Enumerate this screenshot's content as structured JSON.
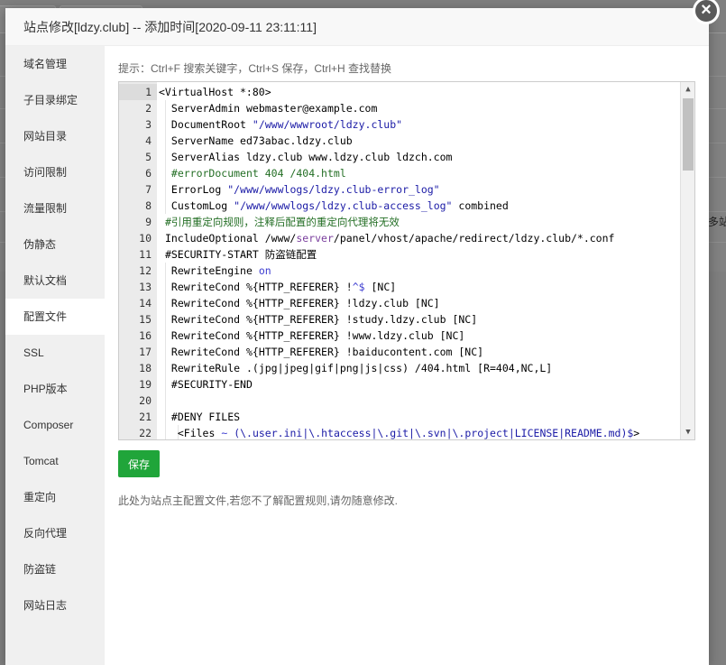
{
  "background": {
    "right_text": "多站"
  },
  "modal": {
    "title": "站点修改[ldzy.club] -- 添加时间[2020-09-11 23:11:11]",
    "close_glyph": "×"
  },
  "sidebar": {
    "items": [
      {
        "label": "域名管理"
      },
      {
        "label": "子目录绑定"
      },
      {
        "label": "网站目录"
      },
      {
        "label": "访问限制"
      },
      {
        "label": "流量限制"
      },
      {
        "label": "伪静态"
      },
      {
        "label": "默认文档"
      },
      {
        "label": "配置文件",
        "active": true
      },
      {
        "label": "SSL"
      },
      {
        "label": "PHP版本"
      },
      {
        "label": "Composer"
      },
      {
        "label": "Tomcat"
      },
      {
        "label": "重定向"
      },
      {
        "label": "反向代理"
      },
      {
        "label": "防盗链"
      },
      {
        "label": "网站日志"
      }
    ]
  },
  "content": {
    "tip": "提示：Ctrl+F 搜索关键字，Ctrl+S 保存，Ctrl+H 查找替换",
    "save_label": "保存",
    "note": "此处为站点主配置文件,若您不了解配置规则,请勿随意修改."
  },
  "editor": {
    "active_line": 1,
    "lines": [
      {
        "n": "1",
        "indent": 0,
        "parts": [
          [
            "d",
            "<VirtualHost *:80>"
          ]
        ]
      },
      {
        "n": "2",
        "indent": 2,
        "parts": [
          [
            "d",
            "ServerAdmin webmaster@example.com"
          ]
        ]
      },
      {
        "n": "3",
        "indent": 2,
        "parts": [
          [
            "d",
            "DocumentRoot "
          ],
          [
            "s",
            "\"/www/wwwroot/ldzy.club\""
          ]
        ]
      },
      {
        "n": "4",
        "indent": 2,
        "parts": [
          [
            "d",
            "ServerName ed73abac.ldzy.club"
          ]
        ]
      },
      {
        "n": "5",
        "indent": 2,
        "parts": [
          [
            "d",
            "ServerAlias ldzy.club www.ldzy.club ldzch.com"
          ]
        ]
      },
      {
        "n": "6",
        "indent": 2,
        "parts": [
          [
            "c",
            "#errorDocument 404 /404.html"
          ]
        ]
      },
      {
        "n": "7",
        "indent": 2,
        "parts": [
          [
            "d",
            "ErrorLog "
          ],
          [
            "s",
            "\"/www/wwwlogs/ldzy.club-error_log\""
          ]
        ]
      },
      {
        "n": "8",
        "indent": 2,
        "parts": [
          [
            "d",
            "CustomLog "
          ],
          [
            "s",
            "\"/www/wwwlogs/ldzy.club-access_log\""
          ],
          [
            "d",
            " combined"
          ]
        ]
      },
      {
        "n": "9",
        "indent": 1,
        "parts": [
          [
            "c",
            "#引用重定向规则，注释后配置的重定向代理将无效"
          ]
        ]
      },
      {
        "n": "10",
        "indent": 1,
        "parts": [
          [
            "d",
            "IncludeOptional /www/"
          ],
          [
            "p",
            "server"
          ],
          [
            "d",
            "/panel/vhost/apache/redirect/ldzy.club/*.conf"
          ]
        ]
      },
      {
        "n": "11",
        "indent": 1,
        "parts": [
          [
            "d",
            "#SECURITY-START 防盗链配置"
          ]
        ]
      },
      {
        "n": "12",
        "indent": 2,
        "parts": [
          [
            "d",
            "RewriteEngine "
          ],
          [
            "k",
            "on"
          ]
        ]
      },
      {
        "n": "13",
        "indent": 2,
        "parts": [
          [
            "d",
            "RewriteCond %{HTTP_REFERER} !"
          ],
          [
            "k",
            "^$"
          ],
          [
            "d",
            " [NC]"
          ]
        ]
      },
      {
        "n": "14",
        "indent": 2,
        "parts": [
          [
            "d",
            "RewriteCond %{HTTP_REFERER} !ldzy.club [NC]"
          ]
        ]
      },
      {
        "n": "15",
        "indent": 2,
        "parts": [
          [
            "d",
            "RewriteCond %{HTTP_REFERER} !study.ldzy.club [NC]"
          ]
        ]
      },
      {
        "n": "16",
        "indent": 2,
        "parts": [
          [
            "d",
            "RewriteCond %{HTTP_REFERER} !www.ldzy.club [NC]"
          ]
        ]
      },
      {
        "n": "17",
        "indent": 2,
        "parts": [
          [
            "d",
            "RewriteCond %{HTTP_REFERER} !baiducontent.com [NC]"
          ]
        ]
      },
      {
        "n": "18",
        "indent": 2,
        "parts": [
          [
            "d",
            "RewriteRule .(jpg|jpeg|gif|png|js|css) /404.html [R=404,NC,L]"
          ]
        ]
      },
      {
        "n": "19",
        "indent": 2,
        "parts": [
          [
            "d",
            "#SECURITY-END"
          ]
        ]
      },
      {
        "n": "20",
        "indent": 2,
        "parts": [
          [
            "d",
            ""
          ]
        ]
      },
      {
        "n": "21",
        "indent": 2,
        "parts": [
          [
            "d",
            "#DENY FILES"
          ]
        ]
      },
      {
        "n": "22",
        "indent": 3,
        "parts": [
          [
            "d",
            "<Files "
          ],
          [
            "k",
            "~"
          ],
          [
            "d",
            " "
          ],
          [
            "s",
            "(\\.user.ini|\\.htaccess|\\.git|\\.svn|\\.project|LICENSE|README.md)$"
          ],
          [
            "d",
            ">"
          ]
        ]
      }
    ]
  },
  "colors": {
    "accent_green": "#20a53a",
    "string": "#1a1aa6",
    "comment": "#236e24",
    "keyword": "#3b3bd0"
  }
}
